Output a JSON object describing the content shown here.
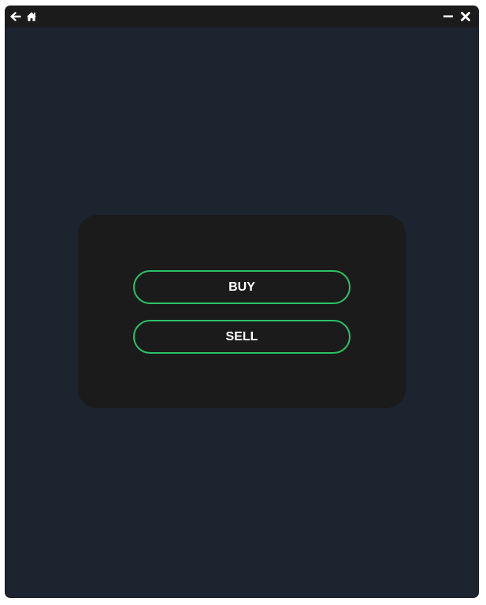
{
  "titlebar": {
    "icons": {
      "back": "arrow-left-icon",
      "home": "home-icon",
      "minimize": "minimize-icon",
      "close": "close-icon"
    }
  },
  "actions": {
    "buy_label": "BUY",
    "sell_label": "SELL"
  },
  "colors": {
    "window_background": "#1c2430",
    "titlebar_background": "#1b1b1b",
    "panel_background": "#1b1b1b",
    "button_border": "#2bc266",
    "button_text": "#ffffff"
  }
}
